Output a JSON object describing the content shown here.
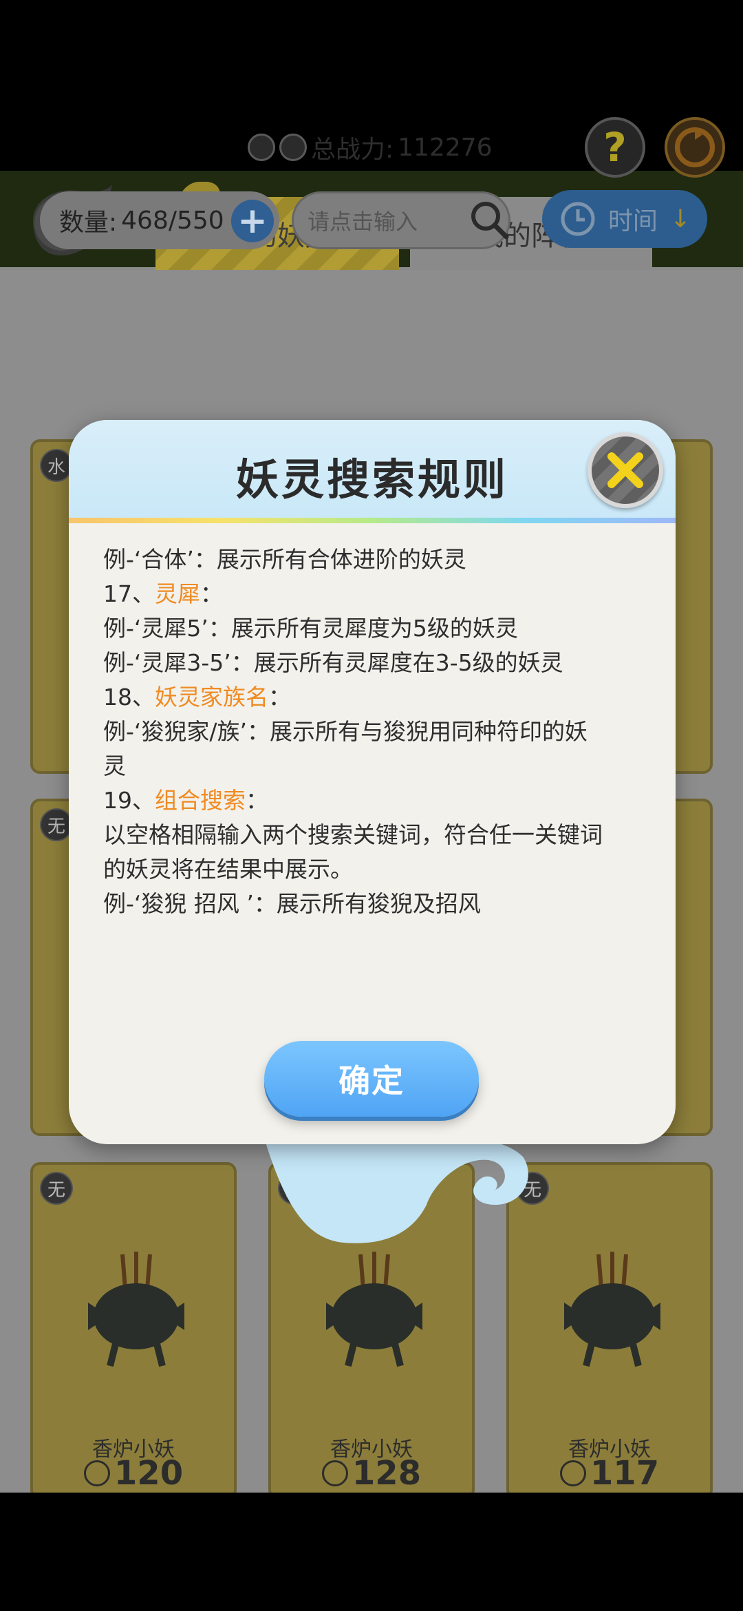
{
  "tabs": {
    "mine": "我的妖灵",
    "team": "我的阵容"
  },
  "power": {
    "label": "总战力:",
    "value": "112276"
  },
  "help": {
    "symbol": "?"
  },
  "count": {
    "label": "数量:",
    "value": "468/550"
  },
  "search": {
    "placeholder": "请点击输入"
  },
  "sort": {
    "label": "时间"
  },
  "cards_row3": [
    {
      "element": "无",
      "name": "香炉小妖",
      "power": "120"
    },
    {
      "element": "无",
      "name": "香炉小妖",
      "power": "128"
    },
    {
      "element": "无",
      "name": "香炉小妖",
      "power": "117"
    }
  ],
  "other_cards": {
    "element_1": "水",
    "element_2": "无"
  },
  "dialog": {
    "title": "妖灵搜索规则",
    "lines": [
      {
        "text": "例-‘合体’：展示所有合体进阶的妖灵"
      },
      {
        "prefix": "17、",
        "highlight": "灵犀",
        "suffix": "："
      },
      {
        "text": "例-‘灵犀5’：展示所有灵犀度为5级的妖灵"
      },
      {
        "text": "例-‘灵犀3-5’：展示所有灵犀度在3-5级的妖灵"
      },
      {
        "prefix": "18、",
        "highlight": "妖灵家族名",
        "suffix": "："
      },
      {
        "text": "例-‘狻猊家/族’：展示所有与狻猊用同种符印的妖"
      },
      {
        "text": "灵"
      },
      {
        "prefix": "19、",
        "highlight": "组合搜索",
        "suffix": "："
      },
      {
        "text": "以空格相隔输入两个搜索关键词，符合任一关键词"
      },
      {
        "text": "的妖灵将在结果中展示。"
      },
      {
        "text": "例-‘狻猊 招风 ’：展示所有狻猊及招风"
      }
    ],
    "ok_label": "确定"
  }
}
